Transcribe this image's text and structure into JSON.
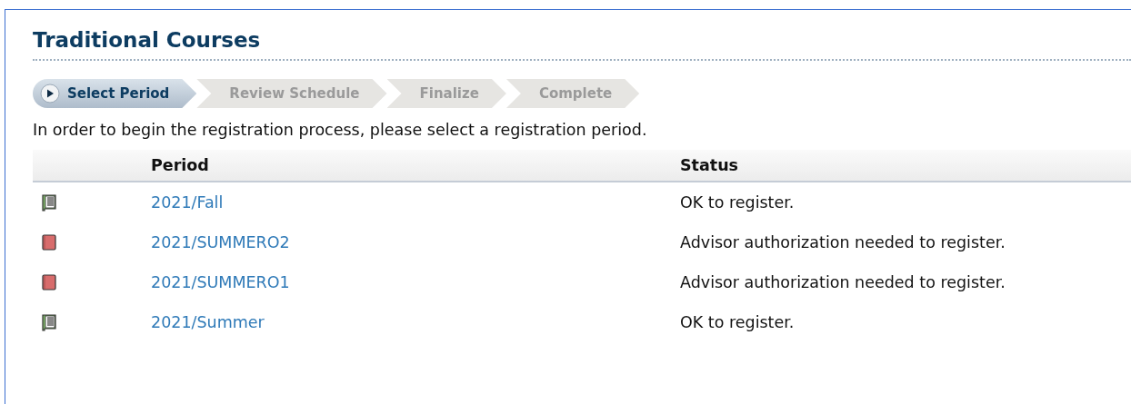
{
  "title": "Traditional Courses",
  "steps": [
    {
      "label": "Select Period",
      "selected": true
    },
    {
      "label": "Review Schedule",
      "selected": false
    },
    {
      "label": "Finalize",
      "selected": false
    },
    {
      "label": "Complete",
      "selected": false
    }
  ],
  "instructions": "In order to begin the registration process, please select a registration period.",
  "table": {
    "columns": [
      "Period",
      "Status"
    ],
    "rows": [
      {
        "kind": "open",
        "period": "2021/Fall",
        "status": "OK to register."
      },
      {
        "kind": "closed",
        "period": "2021/SUMMERO2",
        "status": "Advisor authorization needed to register."
      },
      {
        "kind": "closed",
        "period": "2021/SUMMERO1",
        "status": "Advisor authorization needed to register."
      },
      {
        "kind": "open",
        "period": "2021/Summer",
        "status": "OK to register."
      }
    ]
  }
}
